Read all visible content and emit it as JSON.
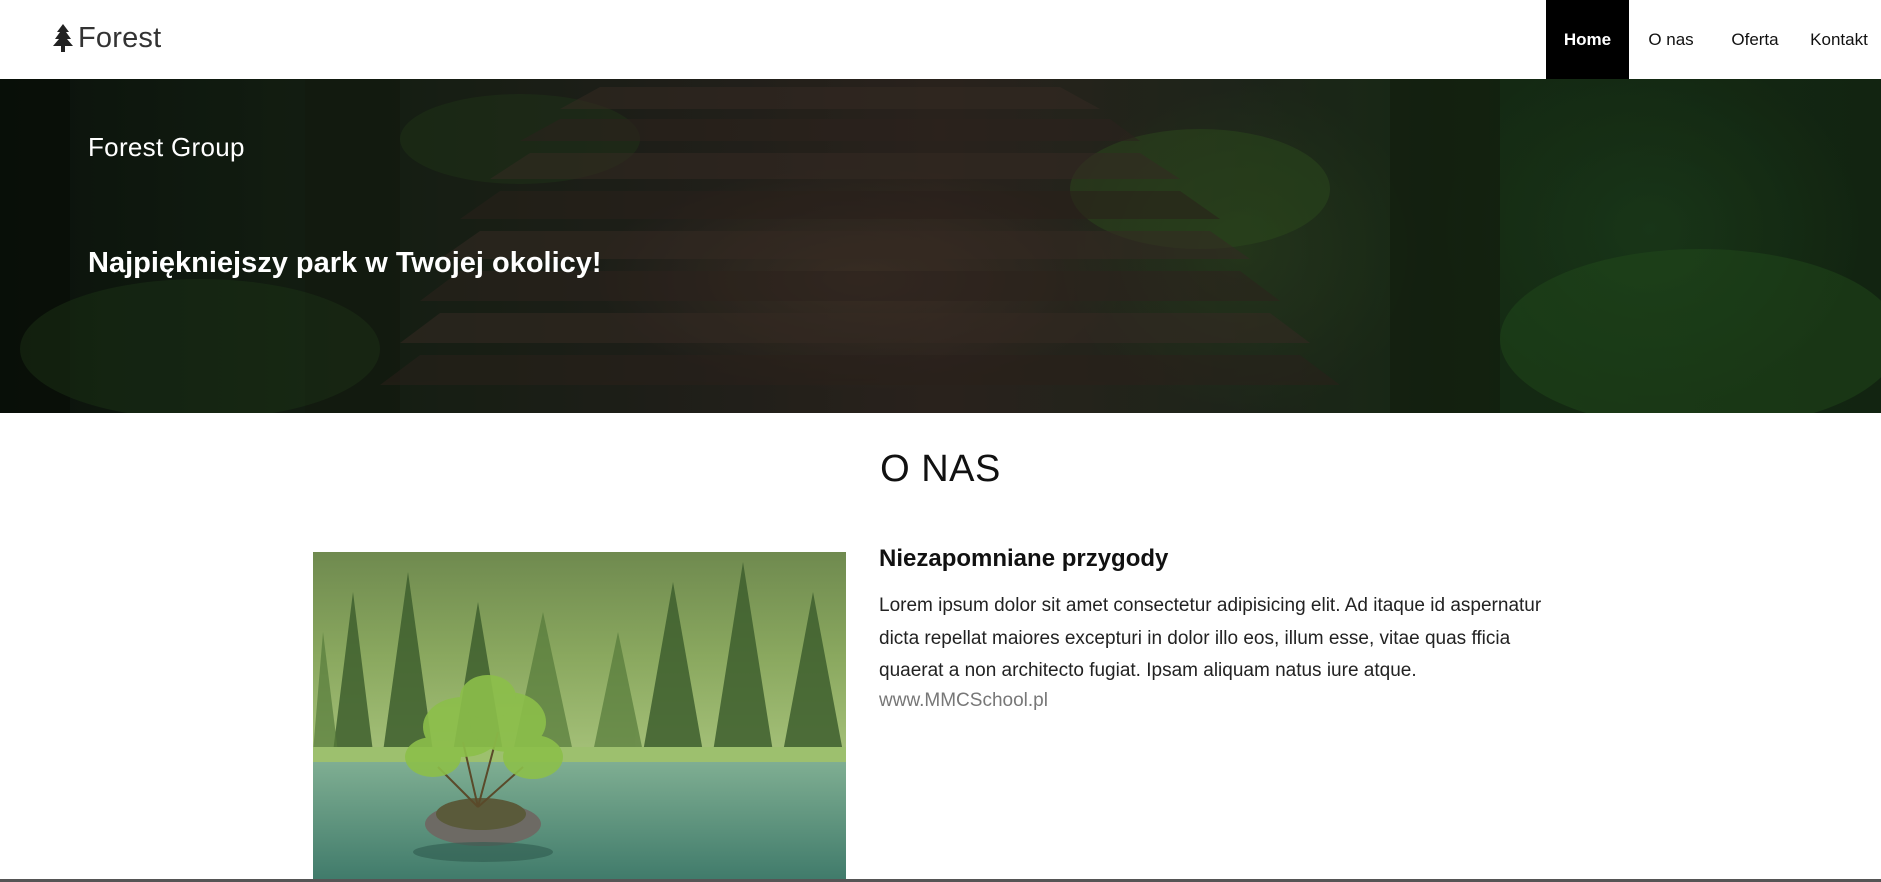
{
  "navbar": {
    "brand": {
      "icon": "tree-icon",
      "text": "Forest"
    },
    "items": [
      {
        "label": "Home",
        "active": true
      },
      {
        "label": "O nas",
        "active": false
      },
      {
        "label": "Oferta",
        "active": false
      },
      {
        "label": "Kontakt",
        "active": false
      }
    ]
  },
  "hero": {
    "subtitle": "Forest Group",
    "title": "Najpiękniejszy park w Twojej okolicy!"
  },
  "about": {
    "section_title": "O NAS",
    "heading": "Niezapomniane przygody",
    "text": "Lorem ipsum dolor sit amet consectetur adipisicing elit. Ad itaque id aspernatur dicta repellat maiores excepturi in dolor illo eos, illum esse, vitae quas fficia quaerat a non architecto fugiat. Ipsam aliquam natus iure atque.",
    "link": "www.MMCSchool.pl"
  },
  "colors": {
    "nav_active_bg": "#000000",
    "nav_active_text": "#ffffff",
    "link_text": "#777777"
  }
}
